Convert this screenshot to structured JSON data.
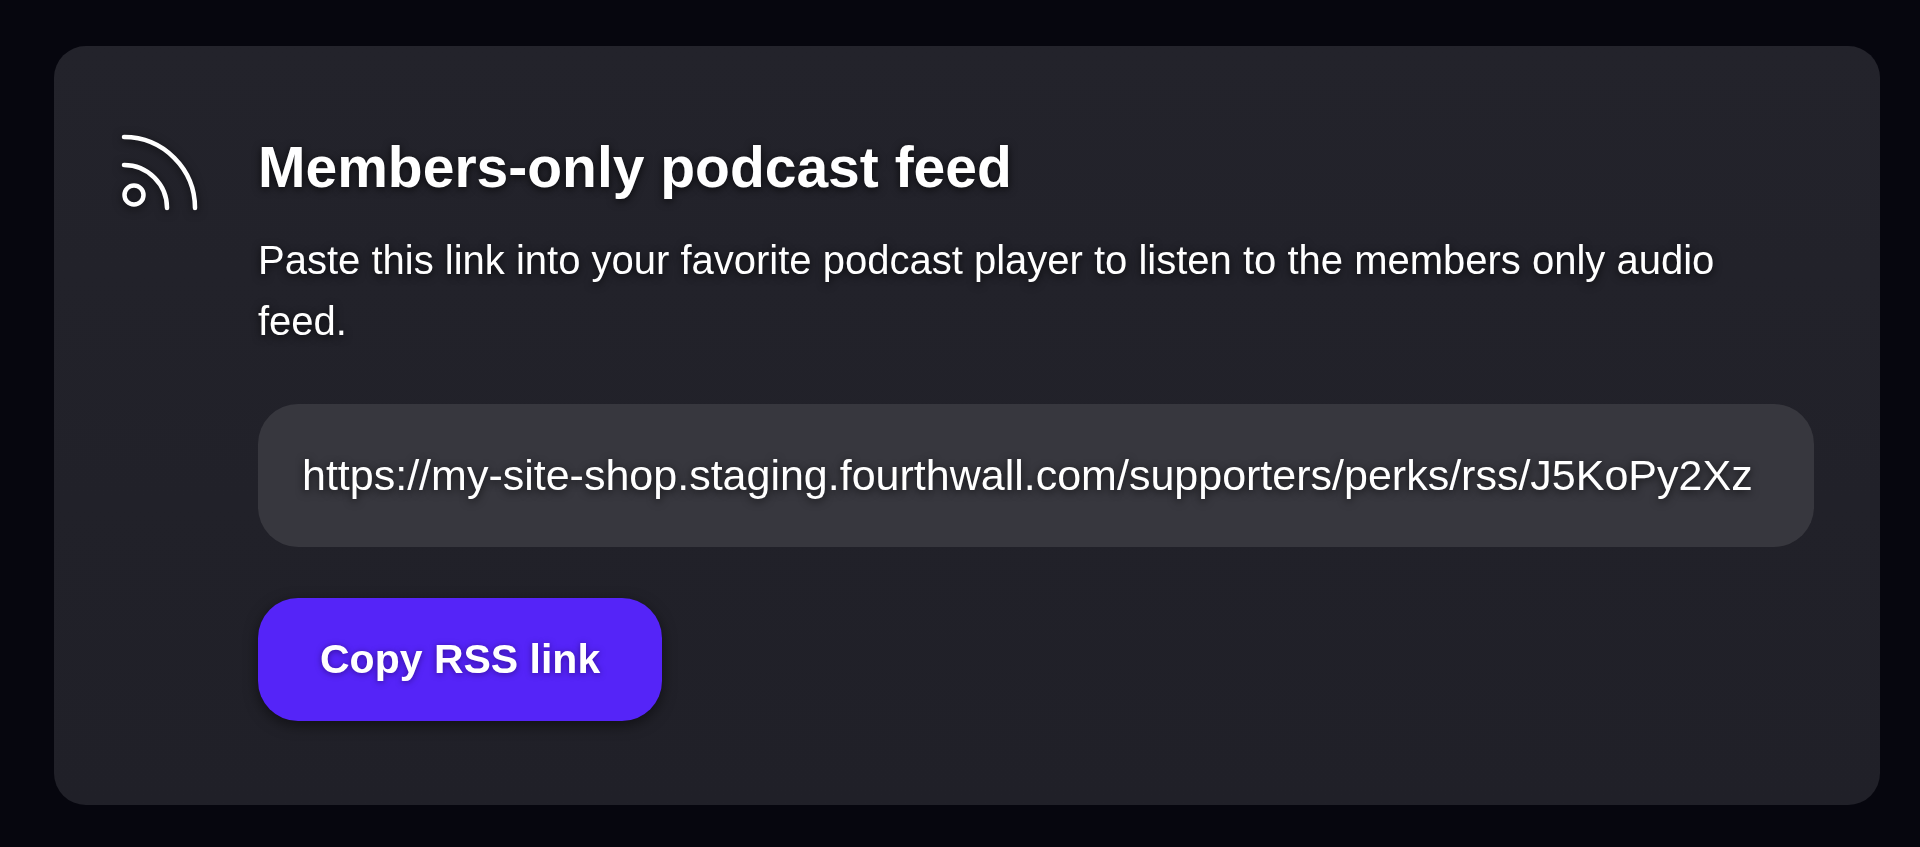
{
  "card": {
    "title": "Members-only podcast feed",
    "description": "Paste this link into your favorite podcast player to listen to the members only audio feed.",
    "feed_field": {
      "value": "https://my-site-shop.staging.fourthwall.com/supporters/perks/rss/J5KoPy2Xz"
    },
    "button": {
      "label": "Copy RSS link"
    }
  }
}
